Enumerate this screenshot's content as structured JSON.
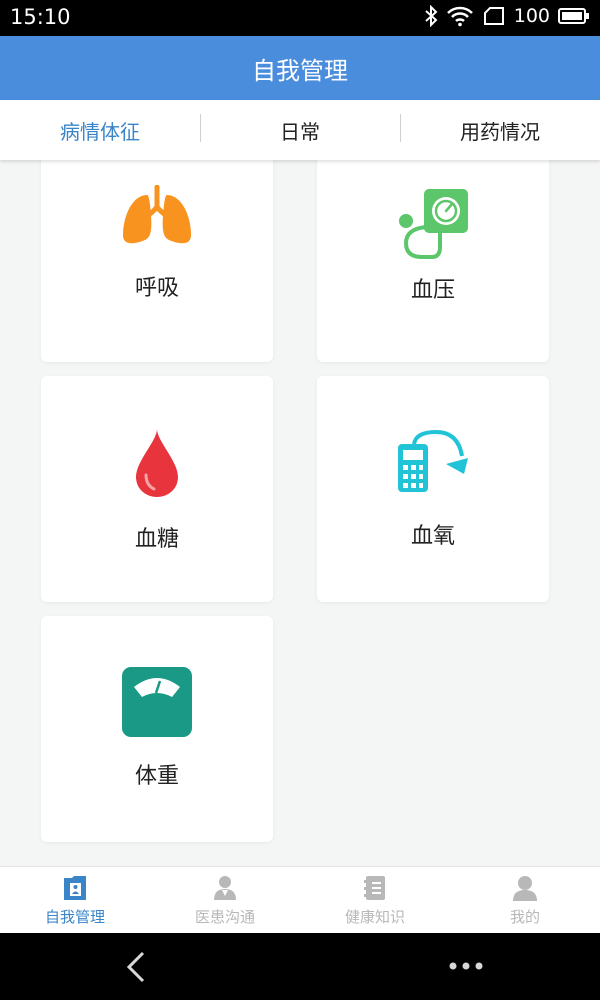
{
  "status_bar": {
    "time": "15:10",
    "battery": "100"
  },
  "app_bar": {
    "title": "自我管理"
  },
  "tabs": [
    {
      "label": "病情体征",
      "active": true
    },
    {
      "label": "日常",
      "active": false
    },
    {
      "label": "用药情况",
      "active": false
    }
  ],
  "cards": [
    {
      "label": "呼吸",
      "icon": "lungs-icon"
    },
    {
      "label": "血压",
      "icon": "blood-pressure-monitor-icon"
    },
    {
      "label": "血糖",
      "icon": "blood-drop-icon"
    },
    {
      "label": "血氧",
      "icon": "pulse-oximeter-icon"
    },
    {
      "label": "体重",
      "icon": "weighing-scale-icon"
    }
  ],
  "bottom_nav": [
    {
      "label": "自我管理",
      "icon": "self-management-icon",
      "active": true
    },
    {
      "label": "医患沟通",
      "icon": "doctor-icon",
      "active": false
    },
    {
      "label": "健康知识",
      "icon": "notebook-icon",
      "active": false
    },
    {
      "label": "我的",
      "icon": "user-icon",
      "active": false
    }
  ],
  "colors": {
    "primary": "#4a8ddd",
    "active_tab": "#3a84c8",
    "orange": "#f7931e",
    "green": "#5cc66a",
    "red": "#e8343c",
    "teal": "#21c3d6",
    "scale": "#1a9a86"
  }
}
